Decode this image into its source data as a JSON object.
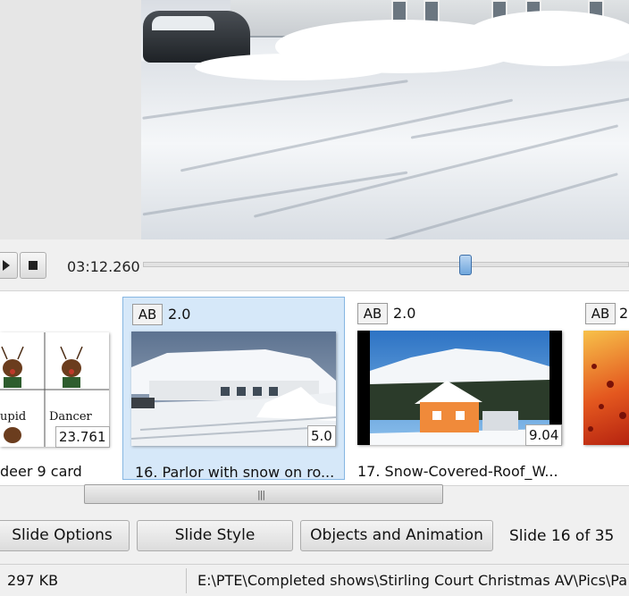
{
  "transport": {
    "time": "03:12.260",
    "position_fraction": 0.65
  },
  "slides": [
    {
      "label": "deer 9 card",
      "duration": "23.761",
      "transition_duration": ""
    },
    {
      "label": "16. Parlor with snow on ro...",
      "duration": "5.0",
      "ab": "AB",
      "transition_duration": "2.0",
      "selected": true
    },
    {
      "label": "17. Snow-Covered-Roof_W...",
      "duration": "9.04",
      "ab": "AB",
      "transition_duration": "2.0"
    },
    {
      "ab": "AB",
      "transition_duration": "2"
    }
  ],
  "reindeer": {
    "left_name": "upid",
    "right_name": "Dancer"
  },
  "buttons": {
    "slide_options": "Slide Options",
    "slide_style": "Slide Style",
    "objects_animation": "Objects and Animation"
  },
  "slide_count": "Slide 16 of 35",
  "status": {
    "size": "297 KB",
    "path": "E:\\PTE\\Completed shows\\Stirling Court Christmas AV\\Pics\\Pa"
  }
}
